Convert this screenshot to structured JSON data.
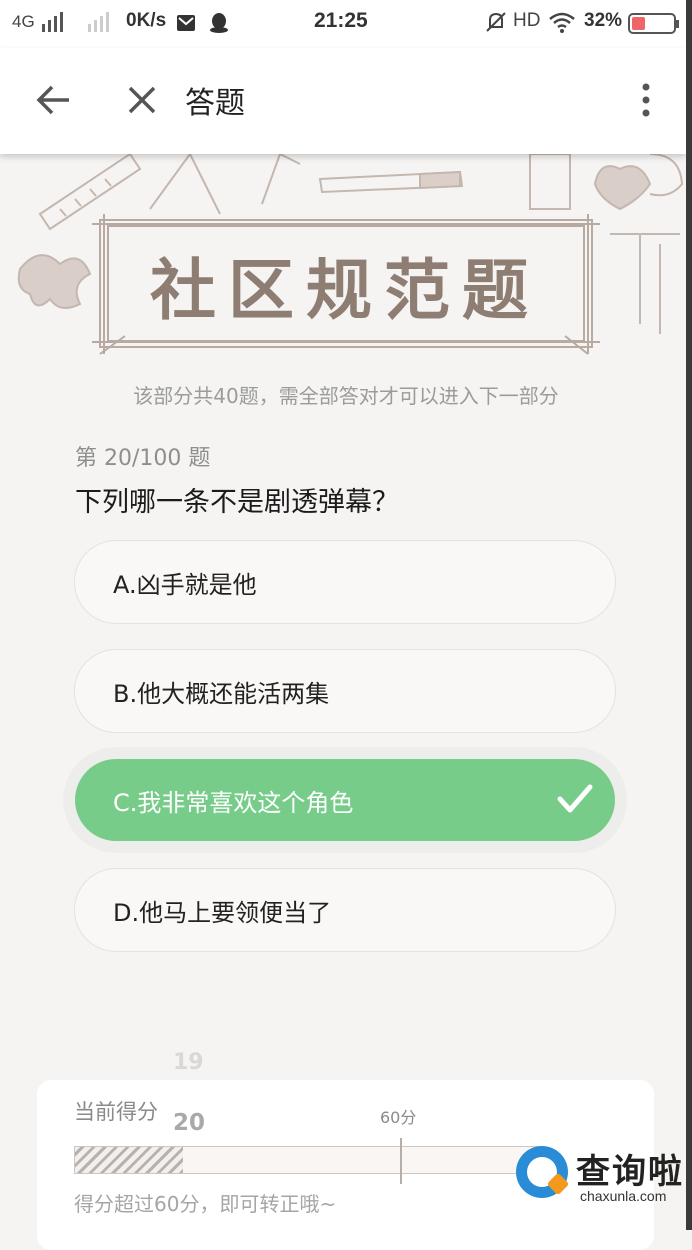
{
  "status_bar": {
    "network": "4G",
    "speed": "0K/s",
    "time": "21:25",
    "hd": "HD",
    "battery": "32%"
  },
  "app_bar": {
    "title": "答题",
    "back_icon": "arrow-left-icon",
    "close_icon": "close-icon",
    "more_icon": "more-vertical-icon"
  },
  "banner": {
    "title": "社区规范题",
    "subtitle": "该部分共40题，需全部答对才可以进入下一部分"
  },
  "quiz": {
    "question_number": "第 20/100 题",
    "question": "下列哪一条不是剧透弹幕？",
    "options": [
      {
        "label": "A.凶手就是他",
        "selected": false
      },
      {
        "label": "B.他大概还能活两集",
        "selected": false
      },
      {
        "label": "C.我非常喜欢这个角色",
        "selected": true
      },
      {
        "label": "D.他马上要领便当了",
        "selected": false
      }
    ],
    "selected_color": "#78cc8a"
  },
  "score": {
    "previous": "19",
    "label": "当前得分",
    "value": "20",
    "threshold_label": "60分",
    "progress": 0.2,
    "hint": "得分超过60分，即可转正哦~"
  },
  "watermark": {
    "name": "查询啦",
    "url": "chaxunla.com"
  }
}
